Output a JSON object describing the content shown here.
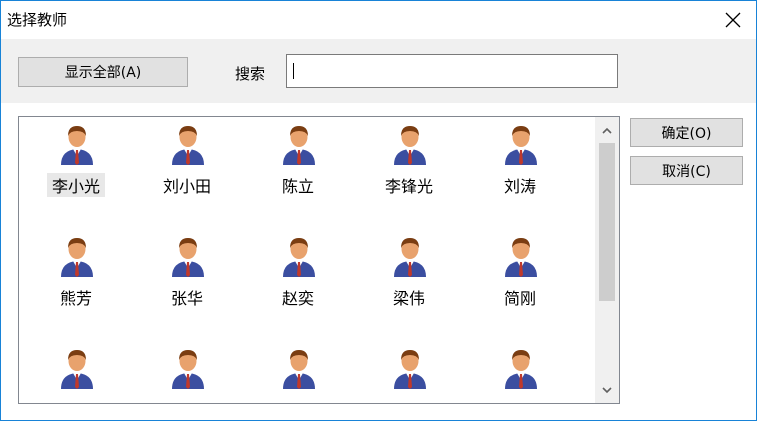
{
  "dialog": {
    "title": "选择教师",
    "show_all_label": "显示全部(A)",
    "search_label": "搜索",
    "search_value": "",
    "ok_label": "确定(O)",
    "cancel_label": "取消(C)"
  },
  "teachers": [
    "李小光",
    "刘小田",
    "陈立",
    "李锋光",
    "刘涛",
    "熊芳",
    "张华",
    "赵奕",
    "梁伟",
    "简刚",
    "",
    "",
    "",
    "",
    ""
  ],
  "selected_teacher": "李小光",
  "icons": {
    "close": "close-icon",
    "person": "teacher-avatar-icon",
    "up": "chevron-up-icon",
    "down": "chevron-down-icon"
  },
  "colors": {
    "window_border": "#1883d7",
    "suit": "#3b4ea0",
    "tie": "#c0392b",
    "face": "#e8a26d",
    "hair": "#7a3d12"
  }
}
